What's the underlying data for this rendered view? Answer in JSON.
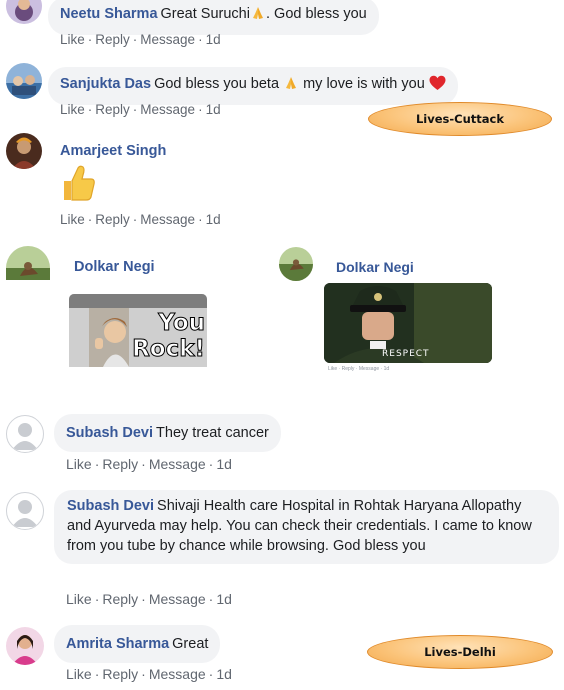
{
  "comments": [
    {
      "author": "Neetu Sharma",
      "text": "Great Suruchi",
      "text_after": ". God bless you",
      "emoji": "folded-hands"
    },
    {
      "author": "Sanjukta Das",
      "text": "God bless you beta",
      "text_mid": "my love is with you",
      "emoji1": "folded-hands",
      "emoji2": "red-heart"
    },
    {
      "author": "Amarjeet Singh",
      "sticker": "thumbs-up"
    },
    {
      "author": "Dolkar Negi",
      "gif_text": "You Rock!"
    },
    {
      "author": "Dolkar Negi",
      "gif_text": "RESPECT",
      "mini_actions": "Like · Reply · Message · 1d"
    },
    {
      "author": "Subash Devi",
      "text": "They treat cancer"
    },
    {
      "author": "Subash Devi",
      "text": "Shivaji Health care Hospital in Rohtak Haryana Allopathy and Ayurveda may help. You can check their credentials. I came to know from you tube by chance while browsing. God bless you"
    },
    {
      "author": "Amrita Sharma",
      "text": "Great"
    }
  ],
  "actions": {
    "like": "Like",
    "reply": "Reply",
    "message": "Message",
    "time": "1d",
    "separator": "·"
  },
  "callouts": [
    {
      "label": "Lives-Cuttack"
    },
    {
      "label": "Lives-Delhi"
    }
  ],
  "colors": {
    "author": "#385898",
    "bubble": "#f2f3f5",
    "meta": "#616770",
    "callout_fill": "#fbc47a",
    "callout_border": "#e08a2a"
  }
}
